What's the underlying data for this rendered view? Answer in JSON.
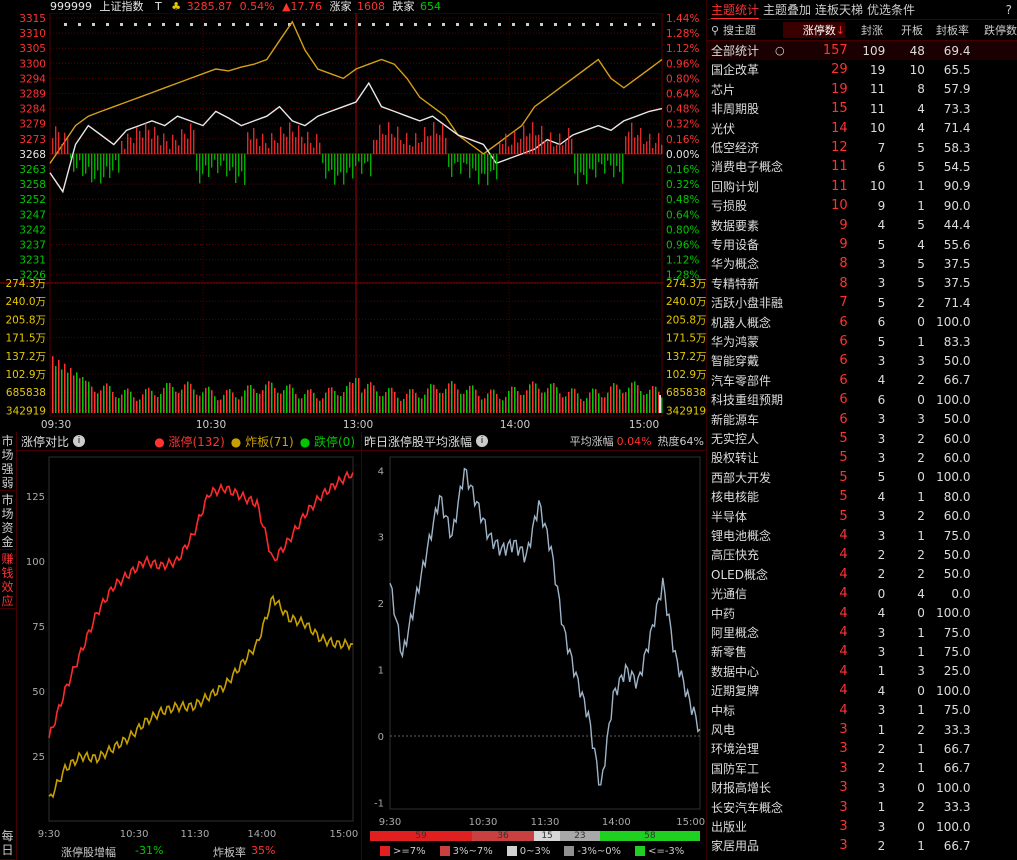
{
  "header": {
    "code": "999999",
    "name": "上证指数",
    "flag": "T",
    "price": "3285.87",
    "pct": "0.54%",
    "change": "▲17.76",
    "up_label": "涨家",
    "up_count": "1608",
    "down_label": "跌家",
    "down_count": "654"
  },
  "price_axis": {
    "left": [
      "3315",
      "3310",
      "3305",
      "3300",
      "3294",
      "3289",
      "3284",
      "3279",
      "3273",
      "3268",
      "3263",
      "3258",
      "3252",
      "3247",
      "3242",
      "3237",
      "3231",
      "3226"
    ],
    "right": [
      "1.44%",
      "1.28%",
      "1.12%",
      "0.96%",
      "0.80%",
      "0.64%",
      "0.48%",
      "0.32%",
      "0.16%",
      "0.00%",
      "0.16%",
      "0.32%",
      "0.48%",
      "0.64%",
      "0.80%",
      "0.96%",
      "1.12%",
      "1.28%"
    ]
  },
  "volume_axis": [
    "274.3万",
    "240.0万",
    "205.8万",
    "171.5万",
    "137.2万",
    "102.9万",
    "685838",
    "342919"
  ],
  "time_axis": [
    "09:30",
    "10:30",
    "13:00",
    "14:00",
    "15:00"
  ],
  "colors": {
    "up": "#ff3232",
    "down": "#00c800",
    "price_line": "#e8e8e8",
    "avg_line": "#d4a017",
    "grid": "#5a0000"
  },
  "right_panel": {
    "tabs": [
      "主题统计",
      "主题叠加",
      "连板天梯",
      "优选条件"
    ],
    "help": "?",
    "search_placeholder": "搜主题",
    "columns": [
      "涨停数",
      "封涨",
      "开板",
      "封板率",
      "跌停数"
    ],
    "rows": [
      {
        "name": "全部统计",
        "limit": "157",
        "seal": "109",
        "open": "48",
        "rate": "69.4",
        "down": ""
      },
      {
        "name": "国企改革",
        "limit": "29",
        "seal": "19",
        "open": "10",
        "rate": "65.5",
        "down": ""
      },
      {
        "name": "芯片",
        "limit": "19",
        "seal": "11",
        "open": "8",
        "rate": "57.9",
        "down": ""
      },
      {
        "name": "非周期股",
        "limit": "15",
        "seal": "11",
        "open": "4",
        "rate": "73.3",
        "down": ""
      },
      {
        "name": "光伏",
        "limit": "14",
        "seal": "10",
        "open": "4",
        "rate": "71.4",
        "down": ""
      },
      {
        "name": "低空经济",
        "limit": "12",
        "seal": "7",
        "open": "5",
        "rate": "58.3",
        "down": ""
      },
      {
        "name": "消费电子概念",
        "limit": "11",
        "seal": "6",
        "open": "5",
        "rate": "54.5",
        "down": ""
      },
      {
        "name": "回购计划",
        "limit": "11",
        "seal": "10",
        "open": "1",
        "rate": "90.9",
        "down": ""
      },
      {
        "name": "亏损股",
        "limit": "10",
        "seal": "9",
        "open": "1",
        "rate": "90.0",
        "down": ""
      },
      {
        "name": "数据要素",
        "limit": "9",
        "seal": "4",
        "open": "5",
        "rate": "44.4",
        "down": ""
      },
      {
        "name": "专用设备",
        "limit": "9",
        "seal": "5",
        "open": "4",
        "rate": "55.6",
        "down": ""
      },
      {
        "name": "华为概念",
        "limit": "8",
        "seal": "3",
        "open": "5",
        "rate": "37.5",
        "down": ""
      },
      {
        "name": "专精特新",
        "limit": "8",
        "seal": "3",
        "open": "5",
        "rate": "37.5",
        "down": ""
      },
      {
        "name": "活跃小盘非融",
        "limit": "7",
        "seal": "5",
        "open": "2",
        "rate": "71.4",
        "down": ""
      },
      {
        "name": "机器人概念",
        "limit": "6",
        "seal": "6",
        "open": "0",
        "rate": "100.0",
        "down": ""
      },
      {
        "name": "华为鸿蒙",
        "limit": "6",
        "seal": "5",
        "open": "1",
        "rate": "83.3",
        "down": ""
      },
      {
        "name": "智能穿戴",
        "limit": "6",
        "seal": "3",
        "open": "3",
        "rate": "50.0",
        "down": ""
      },
      {
        "name": "汽车零部件",
        "limit": "6",
        "seal": "4",
        "open": "2",
        "rate": "66.7",
        "down": ""
      },
      {
        "name": "科技重组预期",
        "limit": "6",
        "seal": "6",
        "open": "0",
        "rate": "100.0",
        "down": ""
      },
      {
        "name": "新能源车",
        "limit": "6",
        "seal": "3",
        "open": "3",
        "rate": "50.0",
        "down": ""
      },
      {
        "name": "无实控人",
        "limit": "5",
        "seal": "3",
        "open": "2",
        "rate": "60.0",
        "down": ""
      },
      {
        "name": "股权转让",
        "limit": "5",
        "seal": "3",
        "open": "2",
        "rate": "60.0",
        "down": ""
      },
      {
        "name": "西部大开发",
        "limit": "5",
        "seal": "5",
        "open": "0",
        "rate": "100.0",
        "down": ""
      },
      {
        "name": "核电核能",
        "limit": "5",
        "seal": "4",
        "open": "1",
        "rate": "80.0",
        "down": ""
      },
      {
        "name": "半导体",
        "limit": "5",
        "seal": "3",
        "open": "2",
        "rate": "60.0",
        "down": ""
      },
      {
        "name": "锂电池概念",
        "limit": "4",
        "seal": "3",
        "open": "1",
        "rate": "75.0",
        "down": ""
      },
      {
        "name": "高压快充",
        "limit": "4",
        "seal": "2",
        "open": "2",
        "rate": "50.0",
        "down": ""
      },
      {
        "name": "OLED概念",
        "limit": "4",
        "seal": "2",
        "open": "2",
        "rate": "50.0",
        "down": ""
      },
      {
        "name": "光通信",
        "limit": "4",
        "seal": "0",
        "open": "4",
        "rate": "0.0",
        "down": ""
      },
      {
        "name": "中药",
        "limit": "4",
        "seal": "4",
        "open": "0",
        "rate": "100.0",
        "down": ""
      },
      {
        "name": "阿里概念",
        "limit": "4",
        "seal": "3",
        "open": "1",
        "rate": "75.0",
        "down": ""
      },
      {
        "name": "新零售",
        "limit": "4",
        "seal": "3",
        "open": "1",
        "rate": "75.0",
        "down": ""
      },
      {
        "name": "数据中心",
        "limit": "4",
        "seal": "1",
        "open": "3",
        "rate": "25.0",
        "down": ""
      },
      {
        "name": "近期复牌",
        "limit": "4",
        "seal": "4",
        "open": "0",
        "rate": "100.0",
        "down": ""
      },
      {
        "name": "中标",
        "limit": "4",
        "seal": "3",
        "open": "1",
        "rate": "75.0",
        "down": ""
      },
      {
        "name": "风电",
        "limit": "3",
        "seal": "1",
        "open": "2",
        "rate": "33.3",
        "down": ""
      },
      {
        "name": "环境治理",
        "limit": "3",
        "seal": "2",
        "open": "1",
        "rate": "66.7",
        "down": ""
      },
      {
        "name": "国防军工",
        "limit": "3",
        "seal": "2",
        "open": "1",
        "rate": "66.7",
        "down": ""
      },
      {
        "name": "财报高增长",
        "limit": "3",
        "seal": "3",
        "open": "0",
        "rate": "100.0",
        "down": ""
      },
      {
        "name": "长安汽车概念",
        "limit": "3",
        "seal": "1",
        "open": "2",
        "rate": "33.3",
        "down": ""
      },
      {
        "name": "出版业",
        "limit": "3",
        "seal": "3",
        "open": "0",
        "rate": "100.0",
        "down": ""
      },
      {
        "name": "家居用品",
        "limit": "3",
        "seal": "2",
        "open": "1",
        "rate": "66.7",
        "down": ""
      }
    ]
  },
  "side_tabs": [
    "市场强弱",
    "市场资金",
    "赚钱效应",
    "每日"
  ],
  "limit_panel": {
    "title": "涨停对比",
    "legend": [
      {
        "label": "涨停(132)",
        "color": "#ff3232"
      },
      {
        "label": "炸板(71)",
        "color": "#c8a000"
      },
      {
        "label": "跌停(0)",
        "color": "#00c800"
      }
    ],
    "y_ticks": [
      "125",
      "100",
      "75",
      "50",
      "25"
    ],
    "x_ticks": [
      "9:30",
      "10:30",
      "11:30",
      "14:00",
      "15:00"
    ],
    "footer_left_label": "涨停股增幅",
    "footer_left_value": "-31%",
    "footer_right_label": "炸板率",
    "footer_right_value": "35%"
  },
  "yday_panel": {
    "title": "昨日涨停股平均涨幅",
    "avg_label": "平均涨幅",
    "avg_value": "0.04%",
    "heat_label": "热度",
    "heat_value": "64%",
    "y_ticks": [
      "4",
      "3",
      "2",
      "1",
      "0",
      "-1"
    ],
    "x_ticks": [
      "9:30",
      "10:30",
      "11:30",
      "14:00",
      "15:00"
    ],
    "bar_segments": [
      {
        "value": "59",
        "color": "#e02020"
      },
      {
        "value": "36",
        "color": "#c84040"
      },
      {
        "value": "15",
        "color": "#d8d8d8"
      },
      {
        "value": "23",
        "color": "#a8a8a8"
      },
      {
        "value": "58",
        "color": "#20d020"
      }
    ],
    "legend": [
      {
        "label": ">=7%",
        "color": "#e02020"
      },
      {
        "label": "3%~7%",
        "color": "#c84040"
      },
      {
        "label": "0~3%",
        "color": "#d0d0d0"
      },
      {
        "label": "-3%~0%",
        "color": "#909090"
      },
      {
        "label": "<=-3%",
        "color": "#20d020"
      }
    ]
  },
  "chart_data": [
    {
      "type": "line",
      "x_ticks": [
        "9:30",
        "10:30",
        "11:30",
        "14:00",
        "15:00"
      ],
      "y_ticks": [
        25,
        50,
        75,
        100,
        125
      ],
      "ylim": [
        0,
        140
      ],
      "series": [
        {
          "name": "涨停(132)",
          "values": [
            32,
            50,
            65,
            80,
            90,
            95,
            100,
            98,
            100,
            110,
            126,
            128,
            125,
            122,
            100,
            108,
            118,
            125,
            130,
            134
          ]
        },
        {
          "name": "炸板(71)",
          "values": [
            8,
            20,
            25,
            24,
            28,
            32,
            38,
            42,
            44,
            44,
            48,
            52,
            60,
            68,
            86,
            78,
            76,
            70,
            68,
            68
          ]
        }
      ]
    },
    {
      "type": "line",
      "x_ticks": [
        "9:30",
        "10:30",
        "11:30",
        "14:00",
        "15:00"
      ],
      "y_ticks": [
        -1,
        0,
        1,
        2,
        3,
        4
      ],
      "ylim": [
        -1.1,
        4.2
      ],
      "series": [
        {
          "values": [
            2.3,
            1.2,
            2.0,
            2.8,
            3.6,
            3.0,
            4.0,
            3.5,
            3.0,
            2.8,
            2.9,
            2.7,
            3.5,
            2.8,
            1.6,
            0.9,
            0.3,
            -0.8,
            0.6,
            1.0,
            0.8,
            1.5,
            2.3,
            1.2,
            0.6,
            0.1
          ]
        }
      ]
    }
  ]
}
